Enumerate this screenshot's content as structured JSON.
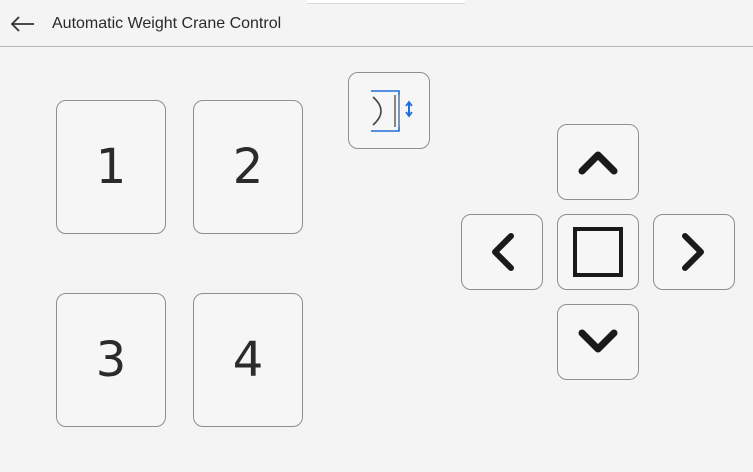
{
  "header": {
    "title": "Automatic Weight Crane Control",
    "back_icon": "arrow-left-icon"
  },
  "position_buttons": [
    {
      "label": "1"
    },
    {
      "label": "2"
    },
    {
      "label": "3"
    },
    {
      "label": "4"
    }
  ],
  "mode_button": {
    "icon": "weighing-pan-vertical-adjust-icon",
    "accent_color": "#1e6fd9"
  },
  "direction_pad": {
    "up_icon": "chevron-up-icon",
    "down_icon": "chevron-down-icon",
    "left_icon": "chevron-left-icon",
    "right_icon": "chevron-right-icon",
    "stop_icon": "square-stop-icon"
  },
  "colors": {
    "background": "#f4f4f4",
    "button_border": "#8f8f8f",
    "icon": "#1a1a1a"
  }
}
